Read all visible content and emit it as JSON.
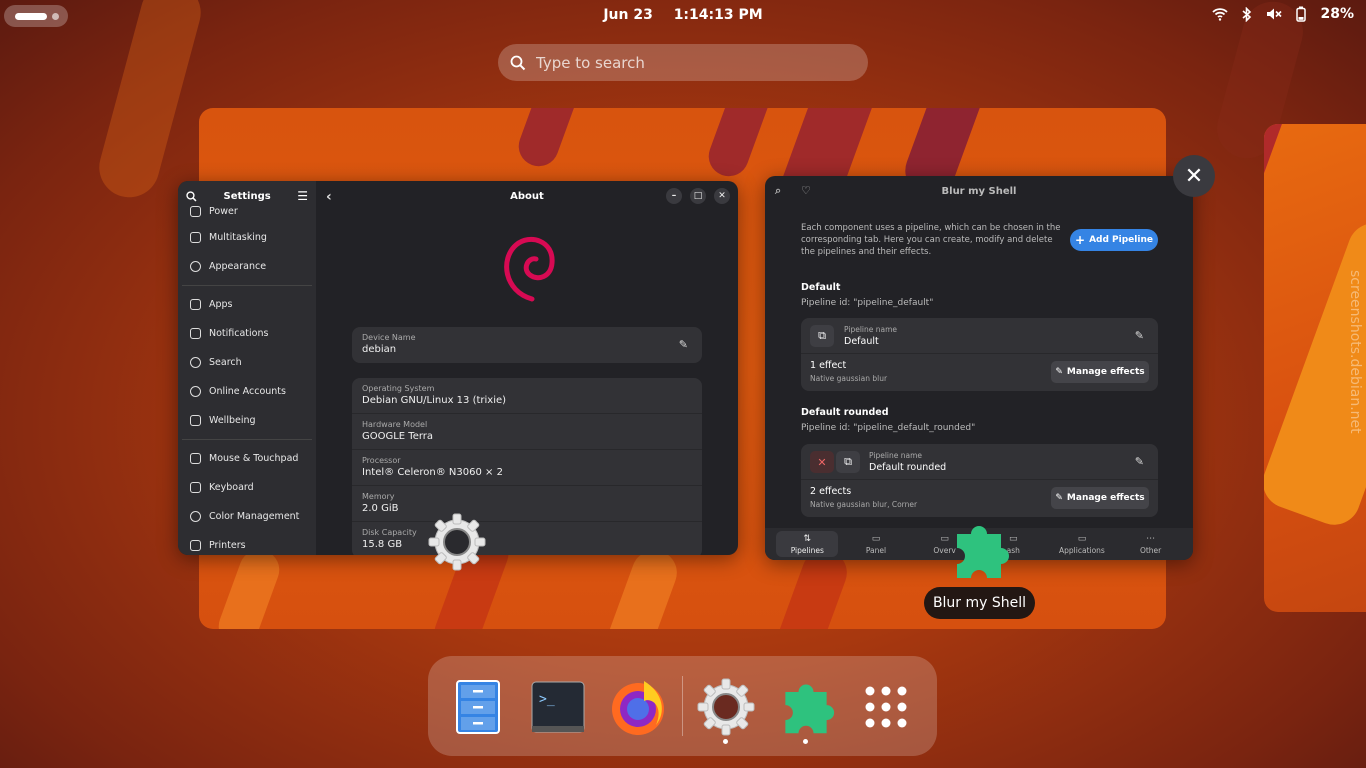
{
  "topbar": {
    "date": "Jun 23",
    "time": "1:14:13 PM",
    "battery": "28%"
  },
  "search": {
    "placeholder": "Type to search"
  },
  "settings_window": {
    "sidebar_title": "Settings",
    "sidebar_items": [
      {
        "label": "Power",
        "icon": "power-icon"
      },
      {
        "label": "Multitasking",
        "icon": "multitasking-icon"
      },
      {
        "label": "Appearance",
        "icon": "appearance-icon"
      },
      {
        "label": "Apps",
        "icon": "apps-icon"
      },
      {
        "label": "Notifications",
        "icon": "bell-icon"
      },
      {
        "label": "Search",
        "icon": "search-icon"
      },
      {
        "label": "Online Accounts",
        "icon": "at-icon"
      },
      {
        "label": "Wellbeing",
        "icon": "wellbeing-icon"
      },
      {
        "label": "Mouse & Touchpad",
        "icon": "mouse-icon"
      },
      {
        "label": "Keyboard",
        "icon": "keyboard-icon"
      },
      {
        "label": "Color Management",
        "icon": "palette-icon"
      },
      {
        "label": "Printers",
        "icon": "printer-icon"
      }
    ],
    "page_title": "About",
    "device_name_label": "Device Name",
    "device_name_value": "debian",
    "info_rows": [
      {
        "label": "Operating System",
        "value": "Debian GNU/Linux 13 (trixie)"
      },
      {
        "label": "Hardware Model",
        "value": "GOOGLE Terra"
      },
      {
        "label": "Processor",
        "value": "Intel® Celeron® N3060 × 2"
      },
      {
        "label": "Memory",
        "value": "2.0 GiB"
      },
      {
        "label": "Disk Capacity",
        "value": "15.8 GB"
      }
    ]
  },
  "blur_window": {
    "title": "Blur my Shell",
    "intro": "Each component uses a pipeline, which can be chosen in the corresponding tab. Here you can create, modify and delete the pipelines and their effects.",
    "add_pipeline": "Add Pipeline",
    "pipelines": [
      {
        "title": "Default",
        "id_text": "Pipeline id: \"pipeline_default\"",
        "name_label": "Pipeline name",
        "name_value": "Default",
        "effects": "1 effect",
        "effects_sub": "Native gaussian blur",
        "manage": "Manage effects"
      },
      {
        "title": "Default rounded",
        "id_text": "Pipeline id: \"pipeline_default_rounded\"",
        "name_label": "Pipeline name",
        "name_value": "Default rounded",
        "effects": "2 effects",
        "effects_sub": "Native gaussian blur, Corner",
        "manage": "Manage effects"
      }
    ],
    "tabs": [
      "Pipelines",
      "Panel",
      "Overview",
      "Dash",
      "Applications",
      "Other"
    ],
    "tab_labels_visible": [
      "Pipelines",
      "Panel",
      "Overv",
      "ash",
      "Applications",
      "Other"
    ]
  },
  "tooltip": "Blur my Shell",
  "watermark": "screenshots.debian.net",
  "dock": {
    "items": [
      "files-icon",
      "terminal-icon",
      "firefox-icon",
      "settings-gear-icon",
      "extensions-puzzle-icon",
      "app-grid-icon"
    ]
  },
  "colors": {
    "accent": "#3584e4",
    "debian_red": "#d70a53",
    "puzzle_green": "#2ec27e"
  }
}
